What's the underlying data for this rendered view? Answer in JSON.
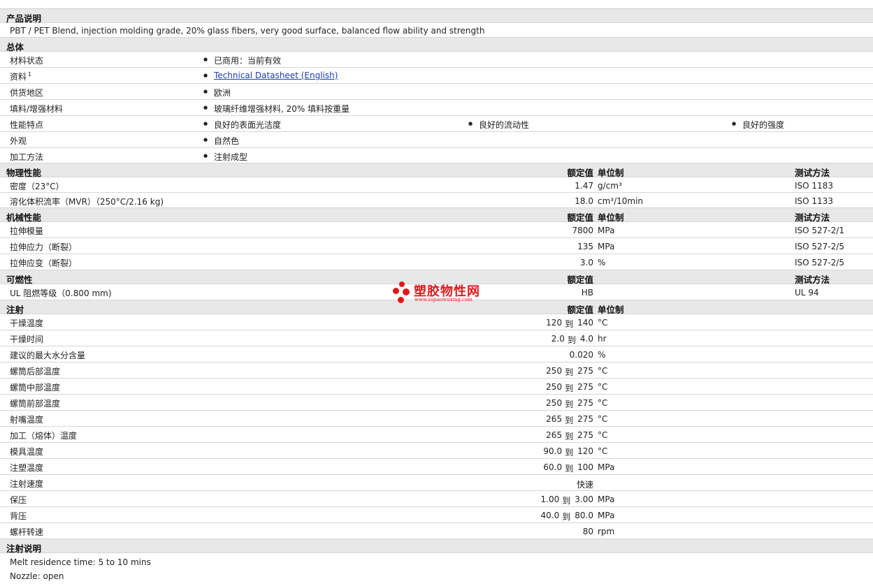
{
  "sections": {
    "product": "产品说明",
    "general": "总体",
    "physical": "物理性能",
    "mechanical": "机械性能",
    "flammability": "可燃性",
    "injection": "注射",
    "injection_notes": "注射说明"
  },
  "headers": {
    "nominal": "额定值",
    "unit": "单位制",
    "test": "测试方法"
  },
  "product_desc": "PBT / PET Blend, injection molding grade, 20% glass fibers, very good surface, balanced flow ability and strength",
  "general": [
    {
      "label": "材料状态",
      "items": [
        "已商用：当前有效"
      ]
    },
    {
      "label": "资料",
      "sup": "1",
      "items": [
        "Technical Datasheet (English)"
      ]
    },
    {
      "label": "供货地区",
      "items": [
        "欧洲"
      ]
    },
    {
      "label": "填料/增强材料",
      "items": [
        "玻璃纤维增强材料, 20% 填料按重量"
      ]
    },
    {
      "label": "性能特点",
      "items": [
        "良好的表面光洁度",
        "良好的流动性",
        "良好的强度"
      ]
    },
    {
      "label": "外观",
      "items": [
        "自然色"
      ]
    },
    {
      "label": "加工方法",
      "items": [
        "注射成型"
      ]
    }
  ],
  "physical": [
    {
      "label": "密度（23°C）",
      "value": "1.47",
      "unit": "g/cm³",
      "test": "ISO 1183"
    },
    {
      "label": "溶化体积流率（MVR）（250°C/2.16 kg)",
      "value": "18.0",
      "unit": "cm³/10min",
      "test": "ISO 1133"
    }
  ],
  "mechanical": [
    {
      "label": "拉伸模量",
      "value": "7800",
      "unit": "MPa",
      "test": "ISO 527-2/1"
    },
    {
      "label": "拉伸应力（断裂）",
      "value": "135",
      "unit": "MPa",
      "test": "ISO 527-2/5"
    },
    {
      "label": "拉伸应变（断裂）",
      "value": "3.0",
      "unit": "%",
      "test": "ISO 527-2/5"
    }
  ],
  "flammability": [
    {
      "label": "UL 阻燃等级（0.800 mm)",
      "value": "HB",
      "test": "UL 94"
    }
  ],
  "injection": [
    {
      "label": "干燥温度",
      "lo": "120",
      "to": "到",
      "hi": "140",
      "unit": "°C"
    },
    {
      "label": "干燥时间",
      "lo": "2.0",
      "to": "到",
      "hi": "4.0",
      "unit": "hr"
    },
    {
      "label": "建议的最大水分含量",
      "value": "0.020",
      "unit": "%"
    },
    {
      "label": "螺筒后部温度",
      "lo": "250",
      "to": "到",
      "hi": "275",
      "unit": "°C"
    },
    {
      "label": "螺筒中部温度",
      "lo": "250",
      "to": "到",
      "hi": "275",
      "unit": "°C"
    },
    {
      "label": "螺筒前部温度",
      "lo": "250",
      "to": "到",
      "hi": "275",
      "unit": "°C"
    },
    {
      "label": "射嘴温度",
      "lo": "265",
      "to": "到",
      "hi": "275",
      "unit": "°C"
    },
    {
      "label": "加工（熔体）温度",
      "lo": "265",
      "to": "到",
      "hi": "275",
      "unit": "°C"
    },
    {
      "label": "模具温度",
      "lo": "90.0",
      "to": "到",
      "hi": "120",
      "unit": "°C"
    },
    {
      "label": "注塑温度",
      "lo": "60.0",
      "to": "到",
      "hi": "100",
      "unit": "MPa"
    },
    {
      "label": "注射速度",
      "value": "快速"
    },
    {
      "label": "保压",
      "lo": "1.00",
      "to": "到",
      "hi": "3.00",
      "unit": "MPa"
    },
    {
      "label": "背压",
      "lo": "40.0",
      "to": "到",
      "hi": "80.0",
      "unit": "MPa"
    },
    {
      "label": "螺杆转速",
      "value": "80",
      "unit": "rpm"
    }
  ],
  "notes": [
    "Melt residence time: 5 to 10 mins",
    "Nozzle: open"
  ],
  "watermark": {
    "name": "塑胶物性网",
    "url": "www.sujiaowuxing.com",
    "color": "#e3171a"
  },
  "colors": {
    "section_bg": "#e8e8e8",
    "link": "#1a3fb0"
  }
}
